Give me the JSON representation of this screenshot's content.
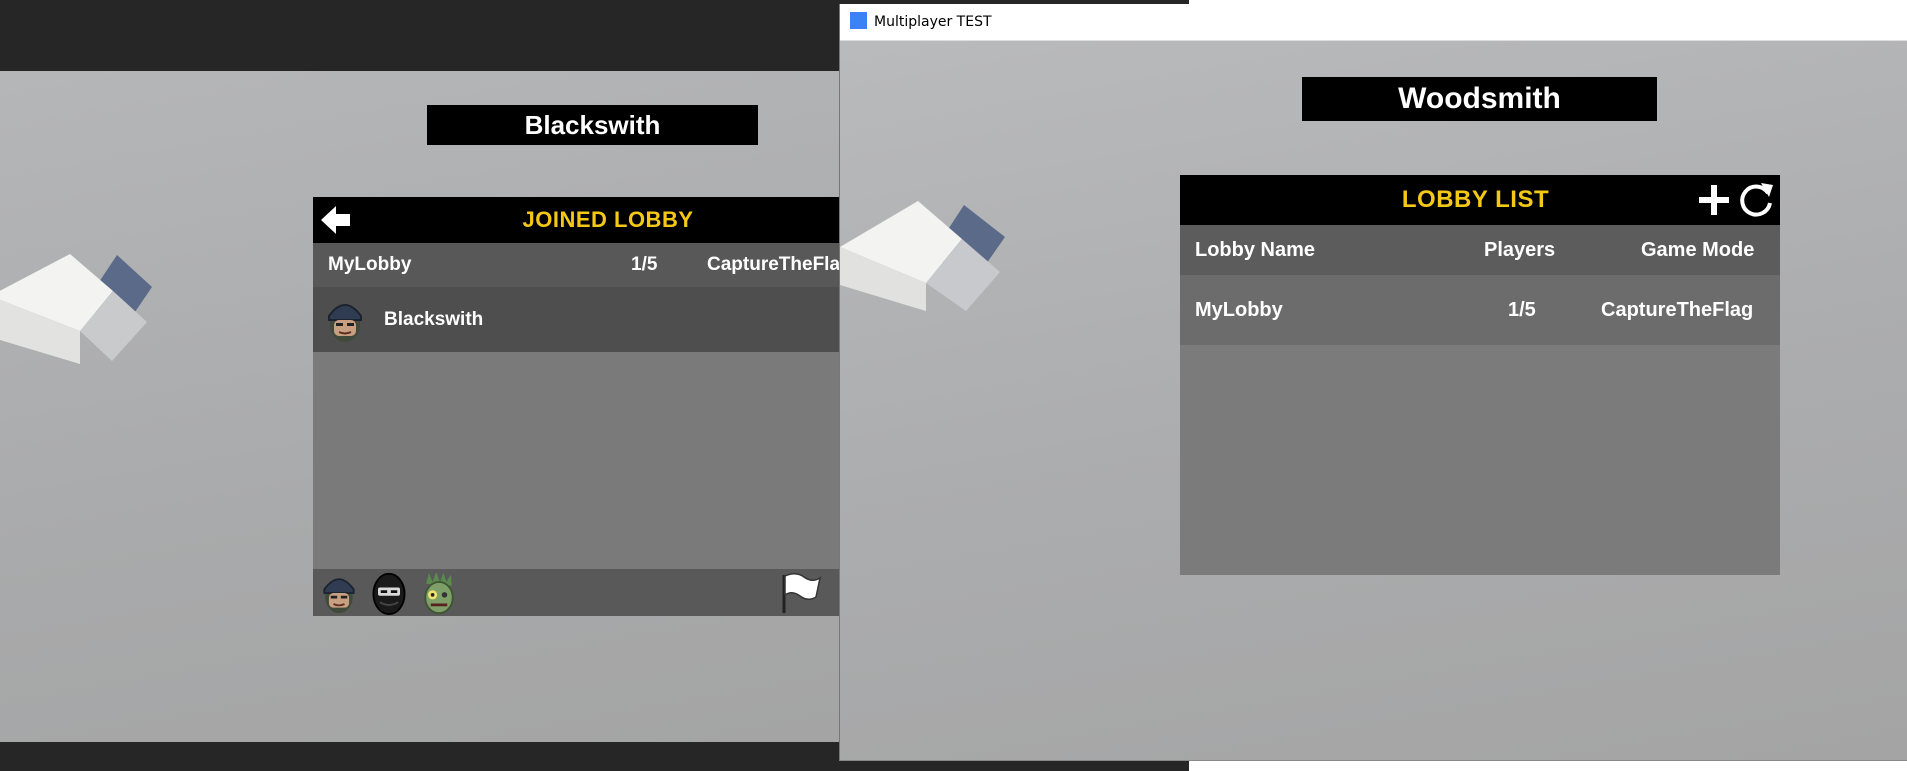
{
  "left_window": {
    "player_name": "Blackswith",
    "joined_lobby": {
      "title": "JOINED LOBBY",
      "lobby_name": "MyLobby",
      "players": "1/5",
      "game_mode": "CaptureTheFla",
      "player_list": [
        {
          "name": "Blackswith",
          "avatar": "soldier-avatar-icon"
        }
      ],
      "character_options": [
        "soldier-avatar-icon",
        "ninja-avatar-icon",
        "zombie-avatar-icon"
      ],
      "footer_icon": "white-flag-icon"
    }
  },
  "right_window": {
    "window_title": "Multiplayer TEST",
    "player_name": "Woodsmith",
    "lobby_list": {
      "title": "LOBBY LIST",
      "columns": [
        "Lobby Name",
        "Players",
        "Game Mode"
      ],
      "rows": [
        {
          "lobby_name": "MyLobby",
          "players": "1/5",
          "game_mode": "CaptureTheFlag"
        }
      ],
      "actions": [
        "plus-icon",
        "refresh-icon"
      ]
    }
  },
  "colors": {
    "title_yellow": "#f3c816",
    "bar_black": "#000000",
    "app_icon_blue": "#3b82f6"
  }
}
